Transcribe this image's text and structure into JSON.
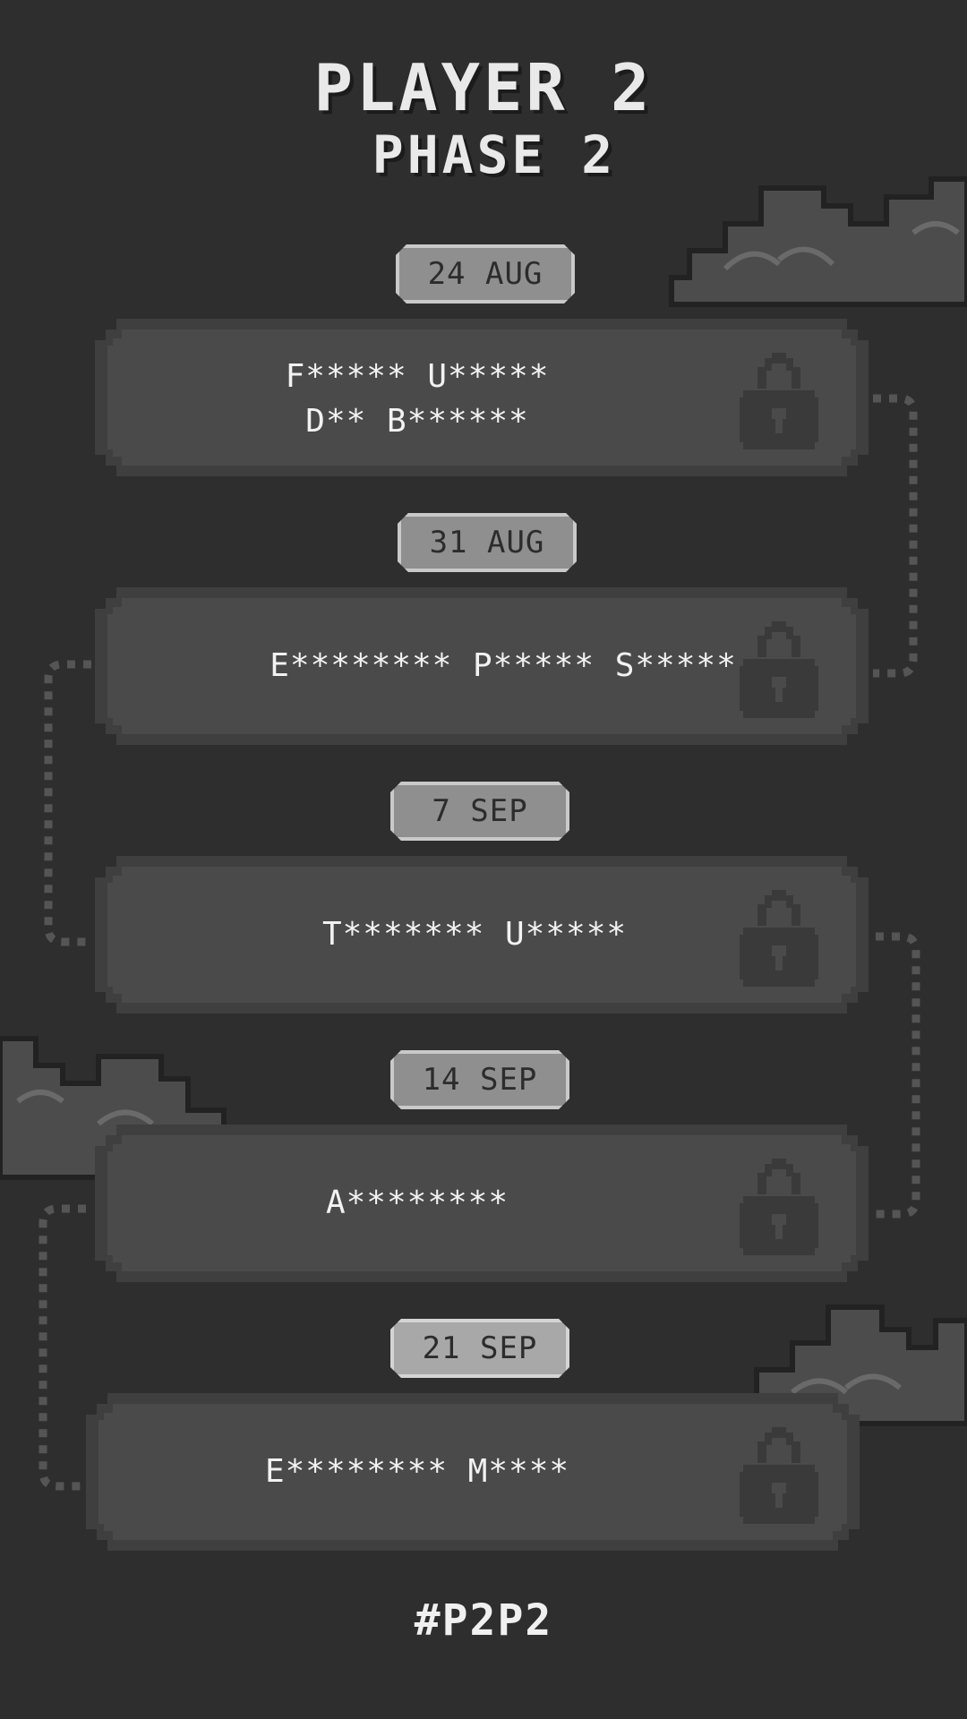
{
  "header": {
    "title": "PLAYER 2",
    "subtitle": "PHASE 2"
  },
  "phases": [
    {
      "date": "24 AUG",
      "lines": [
        "F***** U*****",
        "D** B******"
      ],
      "status": "locked",
      "icon": "lock-icon"
    },
    {
      "date": "31 AUG",
      "lines": [
        "E******** P***** S*****"
      ],
      "status": "locked",
      "icon": "lock-icon"
    },
    {
      "date": "7 SEP",
      "lines": [
        "T******* U*****"
      ],
      "status": "locked",
      "icon": "lock-icon"
    },
    {
      "date": "14 SEP",
      "lines": [
        "A********"
      ],
      "status": "locked",
      "icon": "lock-icon"
    },
    {
      "date": "21 SEP",
      "lines": [
        "E******** M****"
      ],
      "status": "locked",
      "icon": "lock-icon"
    }
  ],
  "footer": {
    "hashtag": "#P2P2"
  },
  "colors": {
    "background": "#2e2e2e",
    "card": "#4a4a4a",
    "badge": "#8f8f8f",
    "text": "#f2f2f2"
  }
}
